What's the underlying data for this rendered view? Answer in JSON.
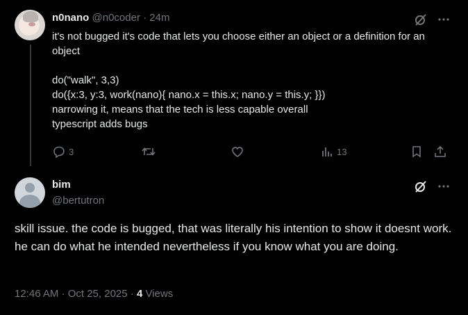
{
  "reply": {
    "display_name": "n0nano",
    "handle": "@n0coder",
    "sep": " · ",
    "time": "24m",
    "text": "it's not bugged it's code that lets you choose either an object or a definition for an object\n\ndo(\"walk\", 3,3)\ndo({x:3, y:3, work(nano){ nano.x = this.x; nano.y = this.y; }})\nnarrowing it, means that the tech is less capable overall\ntypescript adds bugs",
    "reply_count": "3",
    "views_count": "13"
  },
  "main": {
    "display_name": "bim",
    "handle": "@bertutron",
    "text": "skill issue. the code is bugged, that was literally his intention to show it doesnt work. he can do what he intended nevertheless if you know what you are doing.",
    "timestamp": "12:46 AM · Oct 25, 2025 · ",
    "views_count": "4",
    "views_label": " Views"
  },
  "icons": {
    "grok": "grok-icon",
    "more": "more-icon",
    "reply": "reply-icon",
    "repost": "repost-icon",
    "like": "like-icon",
    "views": "views-icon",
    "bookmark": "bookmark-icon",
    "share": "share-icon"
  },
  "colors": {
    "background": "#000000",
    "text": "#e7e9ea",
    "muted": "#71767b",
    "thread_line": "#333639"
  }
}
